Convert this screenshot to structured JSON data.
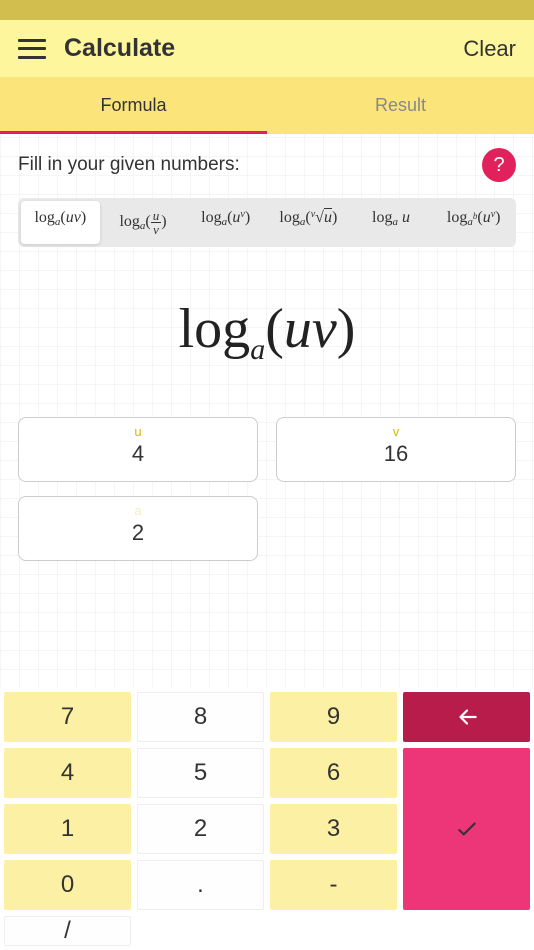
{
  "header": {
    "title": "Calculate",
    "clear": "Clear"
  },
  "tabs": {
    "formula": "Formula",
    "result": "Result"
  },
  "prompt": "Fill in your given numbers:",
  "help_label": "?",
  "formula_chips": [
    "logₐ(uv)",
    "logₐ(u/v)",
    "logₐ(uᵛ)",
    "logₐ(ᵛ√u)",
    "logₐ u",
    "logₐᵇ(uᵛ)"
  ],
  "active_chip": 0,
  "big_formula": {
    "base": "a",
    "arg": "uv"
  },
  "inputs": {
    "u": {
      "label": "u",
      "value": "4"
    },
    "v": {
      "label": "v",
      "value": "16"
    },
    "a": {
      "label": "a",
      "value": "2"
    }
  },
  "keypad": {
    "k7": "7",
    "k8": "8",
    "k9": "9",
    "k4": "4",
    "k5": "5",
    "k6": "6",
    "k1": "1",
    "k2": "2",
    "k3": "3",
    "k0": "0",
    "dot": ".",
    "minus": "-",
    "slash": "/"
  }
}
